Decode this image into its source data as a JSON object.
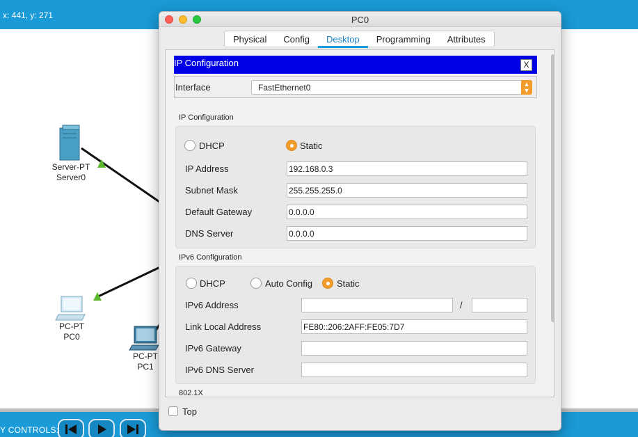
{
  "canvas": {
    "coords": "x: 441, y: 271",
    "controls_label": "Y CONTROLS:",
    "devices": [
      {
        "type": "Server-PT",
        "name": "Server0"
      },
      {
        "type": "PC-PT",
        "name": "PC0"
      },
      {
        "type": "PC-PT",
        "name": "PC1"
      }
    ]
  },
  "window": {
    "title": "PC0",
    "tabs": [
      "Physical",
      "Config",
      "Desktop",
      "Programming",
      "Attributes"
    ],
    "active_tab": "Desktop"
  },
  "ip_config": {
    "header": "IP Configuration",
    "close_label": "X",
    "interface_label": "Interface",
    "interface_value": "FastEthernet0",
    "ipv4": {
      "section_title": "IP Configuration",
      "dhcp_label": "DHCP",
      "static_label": "Static",
      "mode": "Static",
      "ip_label": "IP Address",
      "ip_value": "192.168.0.3",
      "mask_label": "Subnet Mask",
      "mask_value": "255.255.255.0",
      "gateway_label": "Default Gateway",
      "gateway_value": "0.0.0.0",
      "dns_label": "DNS Server",
      "dns_value": "0.0.0.0"
    },
    "ipv6": {
      "section_title": "IPv6 Configuration",
      "dhcp_label": "DHCP",
      "auto_label": "Auto Config",
      "static_label": "Static",
      "mode": "Static",
      "addr_label": "IPv6 Address",
      "addr_value": "",
      "prefix_sep": "/",
      "prefix_value": "",
      "link_local_label": "Link Local Address",
      "link_local_value": "FE80::206:2AFF:FE05:7D7",
      "gateway_label": "IPv6 Gateway",
      "gateway_value": "",
      "dns_label": "IPv6 DNS Server",
      "dns_value": ""
    },
    "dot1x_title": "802.1X"
  },
  "footer": {
    "top_label": "Top",
    "top_checked": false
  },
  "colors": {
    "accent": "#1a9ad6",
    "header_blue": "#0000e6",
    "radio_on": "#f29c2b",
    "link_triangle": "#5cb82c"
  }
}
